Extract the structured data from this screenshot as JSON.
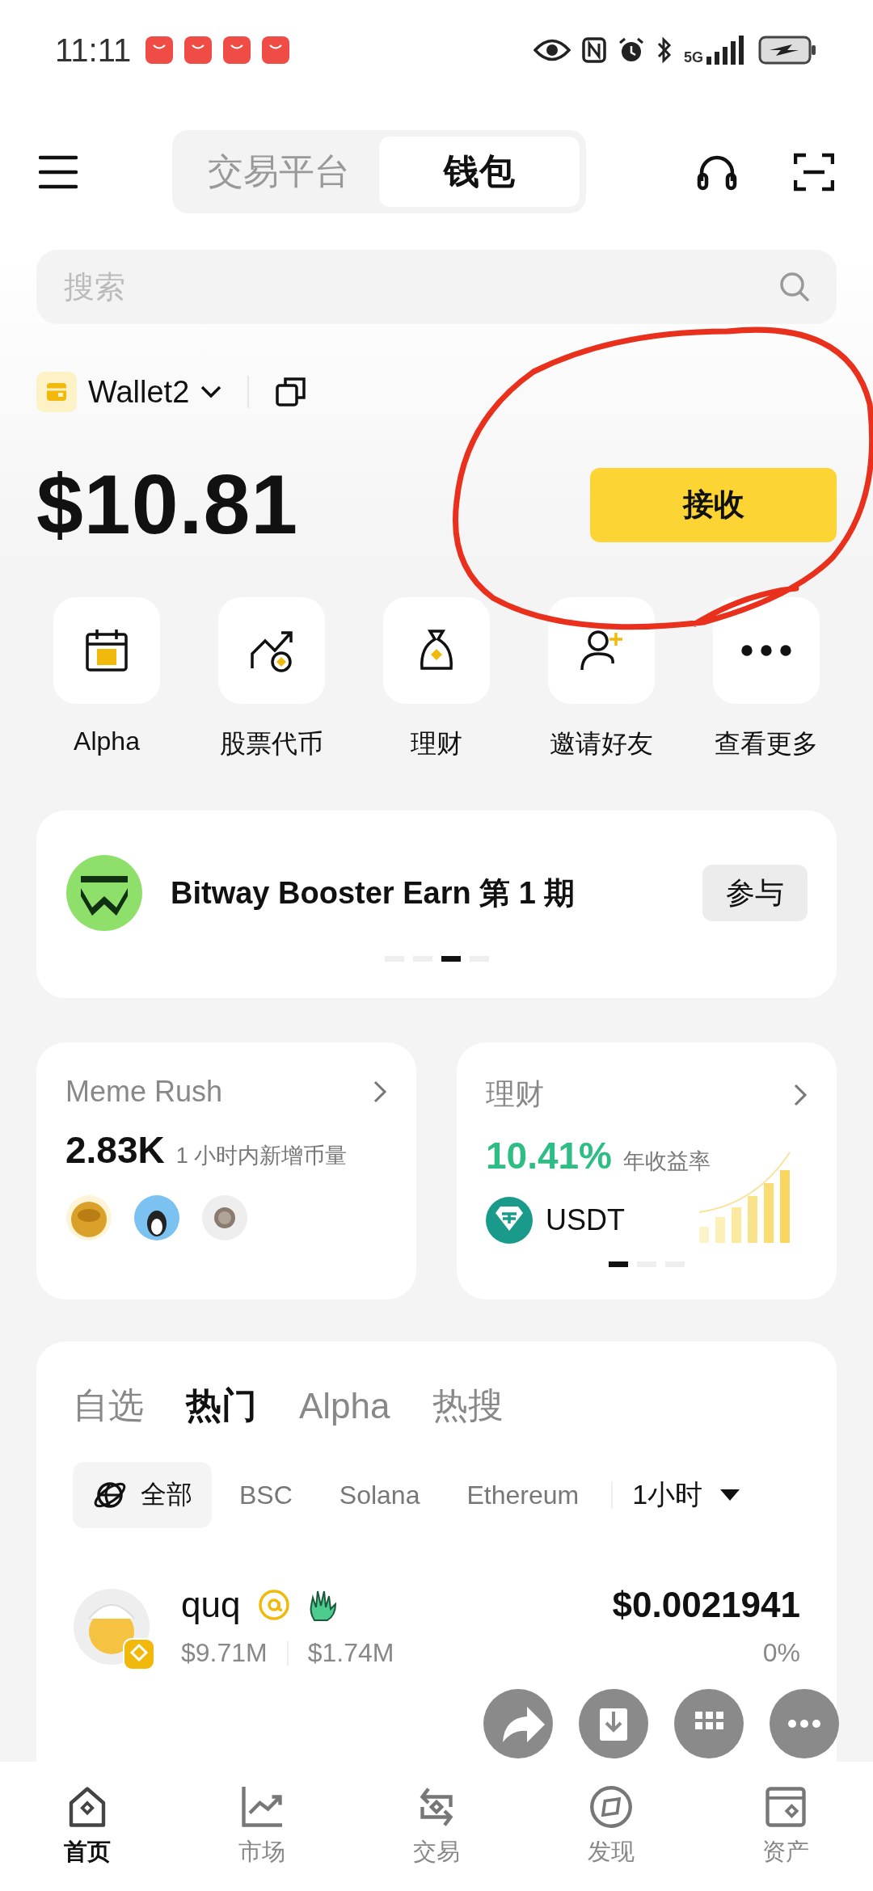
{
  "status_bar": {
    "time": "11:11",
    "network": "5G"
  },
  "header": {
    "tabs": [
      {
        "label": "交易平台",
        "selected": false
      },
      {
        "label": "钱包",
        "selected": true
      }
    ]
  },
  "search": {
    "placeholder": "搜索"
  },
  "wallet": {
    "name": "Wallet2",
    "balance": "$10.81",
    "receive_button": "接收"
  },
  "shortcuts": [
    "Alpha",
    "股票代币",
    "理财",
    "邀请好友",
    "查看更多"
  ],
  "banner": {
    "title": "Bitway Booster Earn 第 1 期",
    "button": "参与",
    "pages": [
      {
        "selected": false
      },
      {
        "selected": false
      },
      {
        "selected": true
      },
      {
        "selected": false
      }
    ]
  },
  "cards": [
    {
      "title": "Meme Rush",
      "value": "2.83K",
      "caption": "1 小时内新增币量"
    },
    {
      "title": "理财",
      "value": "10.41%",
      "caption": "年收益率",
      "token": "USDT",
      "pages": [
        {
          "selected": true
        },
        {
          "selected": false
        },
        {
          "selected": false
        }
      ]
    }
  ],
  "market": {
    "tabs": [
      {
        "label": "自选",
        "selected": false
      },
      {
        "label": "热门",
        "selected": true
      },
      {
        "label": "Alpha",
        "selected": false
      },
      {
        "label": "热搜",
        "selected": false
      }
    ],
    "chains": [
      {
        "label": "全部",
        "selected": true
      },
      {
        "label": "BSC",
        "selected": false
      },
      {
        "label": "Solana",
        "selected": false
      },
      {
        "label": "Ethereum",
        "selected": false
      }
    ],
    "period": "1小时",
    "rows": [
      {
        "name": "quq",
        "market_cap": "$9.71M",
        "volume": "$1.74M",
        "price": "$0.0021941",
        "change": "0%"
      }
    ]
  },
  "nav": [
    {
      "label": "首页",
      "selected": true
    },
    {
      "label": "市场",
      "selected": false
    },
    {
      "label": "交易",
      "selected": false
    },
    {
      "label": "发现",
      "selected": false
    },
    {
      "label": "资产",
      "selected": false
    }
  ]
}
